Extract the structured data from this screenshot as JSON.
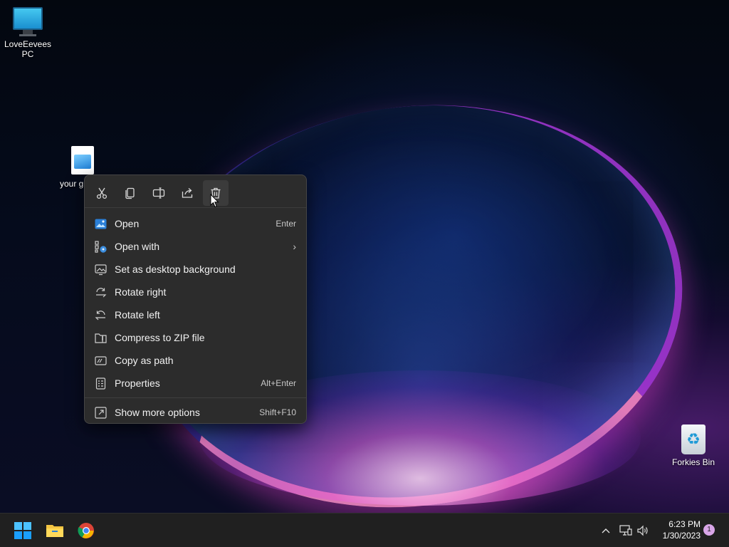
{
  "desktop": {
    "icons": [
      {
        "label": "LoveEevees PC",
        "icon": "monitor-icon"
      },
      {
        "label": "your guestX",
        "icon": "image-file-icon"
      },
      {
        "label": "Forkies Bin",
        "icon": "recycle-bin-icon"
      }
    ]
  },
  "context_menu": {
    "toolbar": [
      {
        "name": "cut",
        "icon": "scissors-icon"
      },
      {
        "name": "copy",
        "icon": "copy-icon"
      },
      {
        "name": "rename",
        "icon": "rename-icon"
      },
      {
        "name": "share",
        "icon": "share-icon"
      },
      {
        "name": "delete",
        "icon": "trash-icon"
      }
    ],
    "items": [
      {
        "label": "Open",
        "shortcut": "Enter",
        "icon": "photos-app-icon"
      },
      {
        "label": "Open with",
        "shortcut": "",
        "icon": "open-with-icon",
        "submenu": true
      },
      {
        "label": "Set as desktop background",
        "shortcut": "",
        "icon": "desktop-background-icon"
      },
      {
        "label": "Rotate right",
        "shortcut": "",
        "icon": "rotate-right-icon"
      },
      {
        "label": "Rotate left",
        "shortcut": "",
        "icon": "rotate-left-icon"
      },
      {
        "label": "Compress to ZIP file",
        "shortcut": "",
        "icon": "zip-folder-icon"
      },
      {
        "label": "Copy as path",
        "shortcut": "",
        "icon": "copy-path-icon"
      },
      {
        "label": "Properties",
        "shortcut": "Alt+Enter",
        "icon": "properties-icon"
      },
      {
        "label": "Show more options",
        "shortcut": "Shift+F10",
        "icon": "more-options-icon"
      }
    ]
  },
  "taskbar": {
    "apps": [
      {
        "name": "Start",
        "icon": "windows-logo-icon"
      },
      {
        "name": "File Explorer",
        "icon": "folder-icon"
      },
      {
        "name": "Google Chrome",
        "icon": "chrome-icon"
      }
    ],
    "tray": {
      "chevron": "^",
      "time": "6:23 PM",
      "date": "1/30/2023",
      "notifications": "1"
    }
  },
  "colors": {
    "menu_bg": "#2c2c2c",
    "taskbar_bg": "#202020",
    "accent": "#0078d4",
    "badge": "#d9a6e8"
  }
}
